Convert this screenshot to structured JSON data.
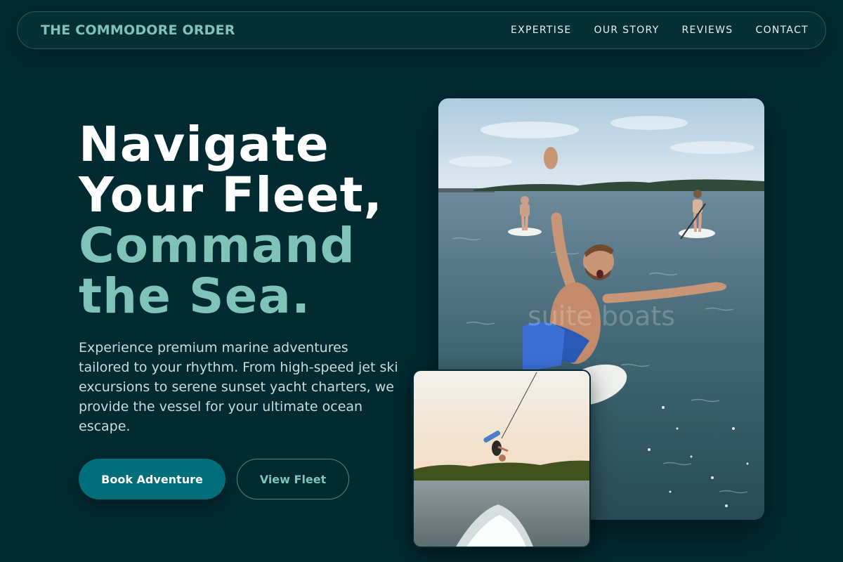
{
  "brand": {
    "name": "THE COMMODORE ORDER"
  },
  "nav": {
    "items": [
      "EXPERTISE",
      "OUR STORY",
      "REVIEWS",
      "CONTACT"
    ]
  },
  "hero": {
    "title_line1": "Navigate",
    "title_line2": "Your Fleet,",
    "title_line3": "Command",
    "title_line4": "the Sea.",
    "description": "Experience premium marine adventures tailored to your rhythm. From high-speed jet ski excursions to serene sunset yacht charters, we provide the vessel for your ultimate ocean escape."
  },
  "buttons": {
    "primary_label": "Book Adventure",
    "secondary_label": "View Fleet"
  },
  "images": {
    "main_watermark": "suite boats",
    "main_alt": "Man jumping off a paddleboard into the sea with paddleboarders in the background",
    "secondary_alt": "Wakeboarder flipping in the air above a boat wake at sunset"
  },
  "colors": {
    "background": "#022a31",
    "accent": "#7fc3b8",
    "primary_button": "#006e7b",
    "text_light": "#c9dbd8"
  }
}
